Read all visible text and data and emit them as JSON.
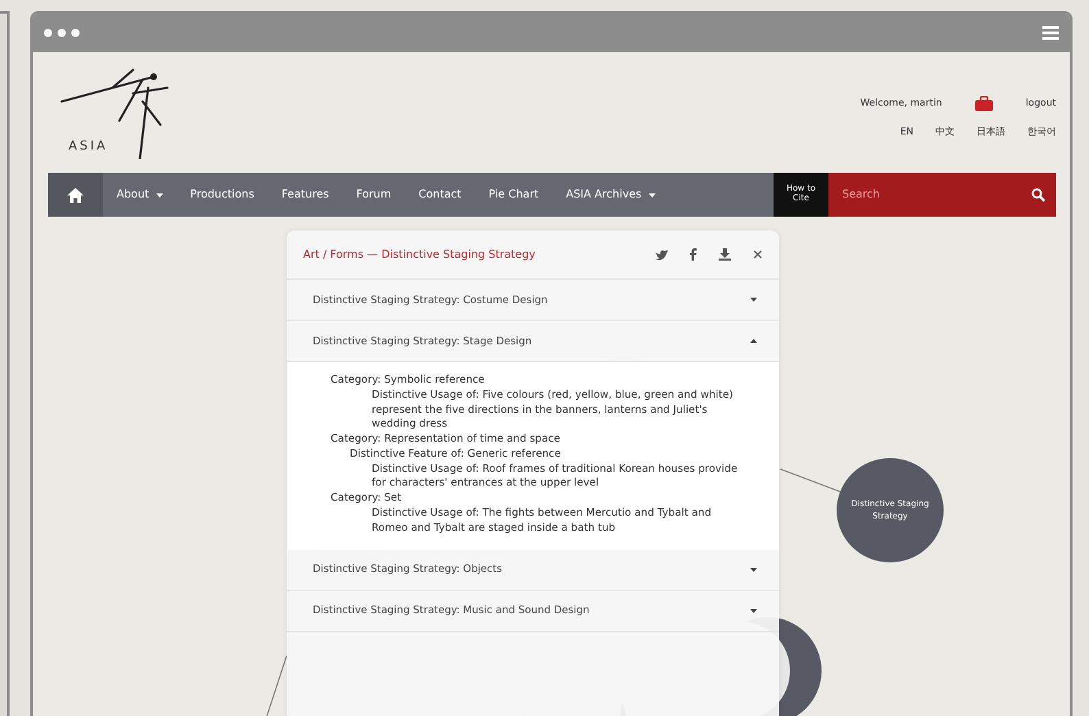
{
  "header": {
    "logo_text": "ASIA",
    "welcome": "Welcome, martin",
    "logout": "logout",
    "languages": [
      {
        "label": "EN"
      },
      {
        "label": "中文"
      },
      {
        "label": "日本語"
      },
      {
        "label": "한국어"
      }
    ]
  },
  "nav": {
    "items": [
      {
        "label": "About",
        "dropdown": true
      },
      {
        "label": "Productions",
        "dropdown": false
      },
      {
        "label": "Features",
        "dropdown": false
      },
      {
        "label": "Forum",
        "dropdown": false
      },
      {
        "label": "Contact",
        "dropdown": false
      },
      {
        "label": "Pie Chart",
        "dropdown": false
      },
      {
        "label": "ASIA Archives",
        "dropdown": true
      }
    ],
    "cite": "How to Cite",
    "search": {
      "placeholder": "Search"
    }
  },
  "graph": {
    "nodes": [
      {
        "label": "Distinctive Staging Strategy"
      }
    ]
  },
  "panel": {
    "title": "Art / Forms — Distinctive Staging Strategy",
    "sections": [
      {
        "title": "Distinctive Staging Strategy: Costume Design",
        "expanded": false
      },
      {
        "title": "Distinctive Staging Strategy: Stage Design",
        "expanded": true,
        "items": [
          {
            "text": "Category: Symbolic reference",
            "children": [
              {
                "text": "Distinctive Usage of: Five colours (red, yellow, blue, green and white) represent the five directions in the banners, lanterns and Juliet's wedding dress"
              }
            ]
          },
          {
            "text": "Category: Representation of time and space",
            "children": [
              {
                "text": "Distinctive Feature of: Generic reference",
                "children": [
                  {
                    "text": "Distinctive Usage of: Roof frames of traditional Korean houses provide for characters' entrances at the upper level"
                  }
                ]
              }
            ]
          },
          {
            "text": "Category: Set",
            "children": [
              {
                "text": "Distinctive Usage of: The fights between Mercutio and Tybalt and Romeo and Tybalt are staged inside a bath tub"
              }
            ]
          }
        ]
      },
      {
        "title": "Distinctive Staging Strategy: Objects",
        "expanded": false
      },
      {
        "title": "Distinctive Staging Strategy: Music and Sound Design",
        "expanded": false
      }
    ]
  }
}
